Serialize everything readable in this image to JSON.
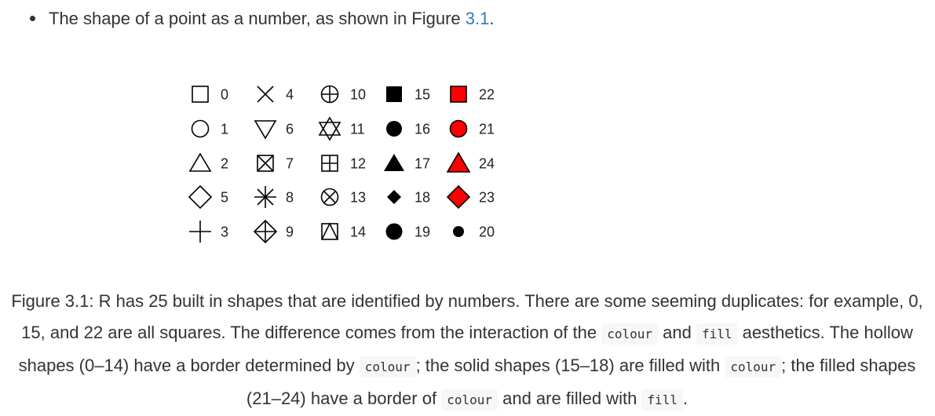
{
  "bullet": {
    "text_before": "The shape of a point as a number, as shown in Figure ",
    "link_text": "3.1",
    "text_after": "."
  },
  "figure": {
    "columns": [
      [
        {
          "id": 0,
          "label": "0"
        },
        {
          "id": 1,
          "label": "1"
        },
        {
          "id": 2,
          "label": "2"
        },
        {
          "id": 5,
          "label": "5"
        },
        {
          "id": 3,
          "label": "3"
        }
      ],
      [
        {
          "id": 4,
          "label": "4"
        },
        {
          "id": 6,
          "label": "6"
        },
        {
          "id": 7,
          "label": "7"
        },
        {
          "id": 8,
          "label": "8"
        },
        {
          "id": 9,
          "label": "9"
        }
      ],
      [
        {
          "id": 10,
          "label": "10"
        },
        {
          "id": 11,
          "label": "11"
        },
        {
          "id": 12,
          "label": "12"
        },
        {
          "id": 13,
          "label": "13"
        },
        {
          "id": 14,
          "label": "14"
        }
      ],
      [
        {
          "id": 15,
          "label": "15"
        },
        {
          "id": 16,
          "label": "16"
        },
        {
          "id": 17,
          "label": "17"
        },
        {
          "id": 18,
          "label": "18"
        },
        {
          "id": 19,
          "label": "19"
        }
      ],
      [
        {
          "id": 22,
          "label": "22"
        },
        {
          "id": 21,
          "label": "21"
        },
        {
          "id": 24,
          "label": "24"
        },
        {
          "id": 23,
          "label": "23"
        },
        {
          "id": 20,
          "label": "20"
        }
      ]
    ],
    "colors": {
      "stroke": "#000000",
      "fill": "#ff0000"
    }
  },
  "caption": {
    "p1": "Figure 3.1: R has 25 built in shapes that are identified by numbers. There are some seeming duplicates: for example, 0, 15, and 22 are all squares. The difference comes from the interaction of the ",
    "c1": "colour",
    "p2": " and ",
    "c2": "fill",
    "p3": " aesthetics. The hollow shapes (0–14) have a border determined by ",
    "c3": "colour",
    "p4": "; the solid shapes (15–18) are filled with ",
    "c4": "colour",
    "p5": "; the filled shapes (21–24) have a border of ",
    "c5": "colour",
    "p6": " and are filled with ",
    "c6": "fill",
    "p7": "."
  }
}
